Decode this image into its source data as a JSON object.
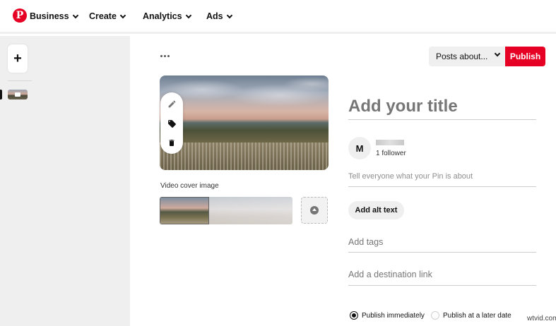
{
  "nav": {
    "items": [
      {
        "label": "Business"
      },
      {
        "label": "Create"
      },
      {
        "label": "Analytics"
      },
      {
        "label": "Ads"
      }
    ]
  },
  "rail": {
    "add_label": "+"
  },
  "toolbar": {
    "board_label": "Posts about...",
    "publish_label": "Publish"
  },
  "media": {
    "cover_label": "Video cover image"
  },
  "form": {
    "title_placeholder": "Add your title",
    "avatar_initial": "M",
    "followers": "1 follower",
    "description_placeholder": "Tell everyone what your Pin is about",
    "alt_text_button": "Add alt text",
    "tags_placeholder": "Add tags",
    "link_placeholder": "Add a destination link"
  },
  "schedule": {
    "options": [
      {
        "label": "Publish immediately",
        "selected": true
      },
      {
        "label": "Publish at a later date",
        "selected": false
      }
    ]
  },
  "watermark": "wtvid.com",
  "colors": {
    "brand": "#e60023",
    "rail_bg": "#efefef"
  }
}
